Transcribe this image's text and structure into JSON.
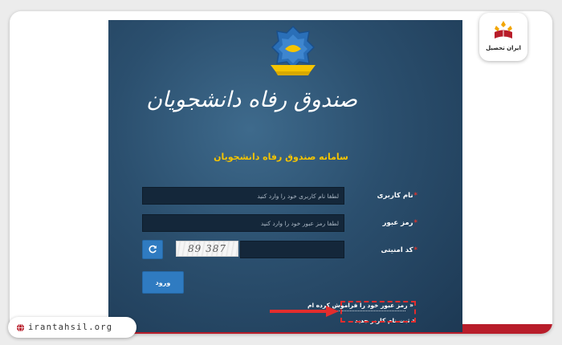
{
  "header": {
    "calligraphy_title": "صندوق رفاه دانشجویان",
    "system_title": "سامانه صندوق رفاه دانشجویان"
  },
  "login_form": {
    "username": {
      "label": "نام کاربری",
      "placeholder": "لطفا نام کاربری خود را وارد کنید",
      "required_mark": "*"
    },
    "password": {
      "label": "رمز عبور",
      "placeholder": "لطفا رمز عبور خود را وارد کنید",
      "required_mark": "*"
    },
    "captcha": {
      "label": "کد امنیتی",
      "image_text": "89 387",
      "required_mark": "*"
    },
    "login_label": "ورود"
  },
  "links": {
    "forgot_password": "رمز عبور خود را فراموش کرده ام",
    "register": "ثبت نام کاربر جدید",
    "bullet": "«"
  },
  "watermark": {
    "brand_name": "ایران تحصیل",
    "url": "irantahsil.org"
  },
  "colors": {
    "panel": "#2b4f6e",
    "accent_yellow": "#f5c400",
    "button_blue": "#2f7bc1",
    "highlight_red": "#e32d2d",
    "brand_red": "#b81d2a"
  }
}
